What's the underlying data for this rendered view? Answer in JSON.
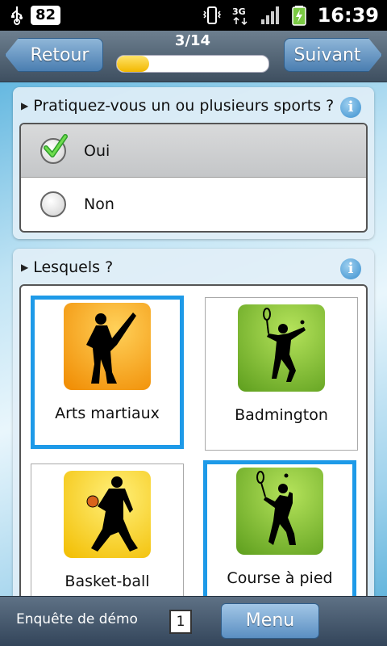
{
  "status_bar": {
    "battery_level": "82",
    "time": "16:39",
    "network": "3G",
    "icons": [
      "usb-icon",
      "vibrate-icon",
      "3g-icon",
      "signal-icon",
      "battery-charging-icon"
    ]
  },
  "header": {
    "back_label": "Retour",
    "next_label": "Suivant",
    "progress_text": "3/14",
    "progress_fraction": 0.214
  },
  "question1": {
    "title": "Pratiquez-vous un ou plusieurs sports ?",
    "options": [
      {
        "label": "Oui",
        "selected": true
      },
      {
        "label": "Non",
        "selected": false
      }
    ]
  },
  "question2": {
    "title": "Lesquels ?",
    "sports": [
      {
        "label": "Arts martiaux",
        "selected": true,
        "icon": "martial-arts-icon"
      },
      {
        "label": "Badmington",
        "selected": false,
        "icon": "badminton-icon"
      },
      {
        "label": "Basket-ball",
        "selected": false,
        "icon": "basketball-icon"
      },
      {
        "label": "Course à pied",
        "selected": true,
        "icon": "tennis-player-icon"
      }
    ]
  },
  "bottom_bar": {
    "survey_name": "Enquête de démo",
    "page_badge": "1",
    "menu_label": "Menu"
  },
  "colors": {
    "accent": "#1e9ae8",
    "progress": "#f2b800",
    "header": "#4a5d70"
  }
}
